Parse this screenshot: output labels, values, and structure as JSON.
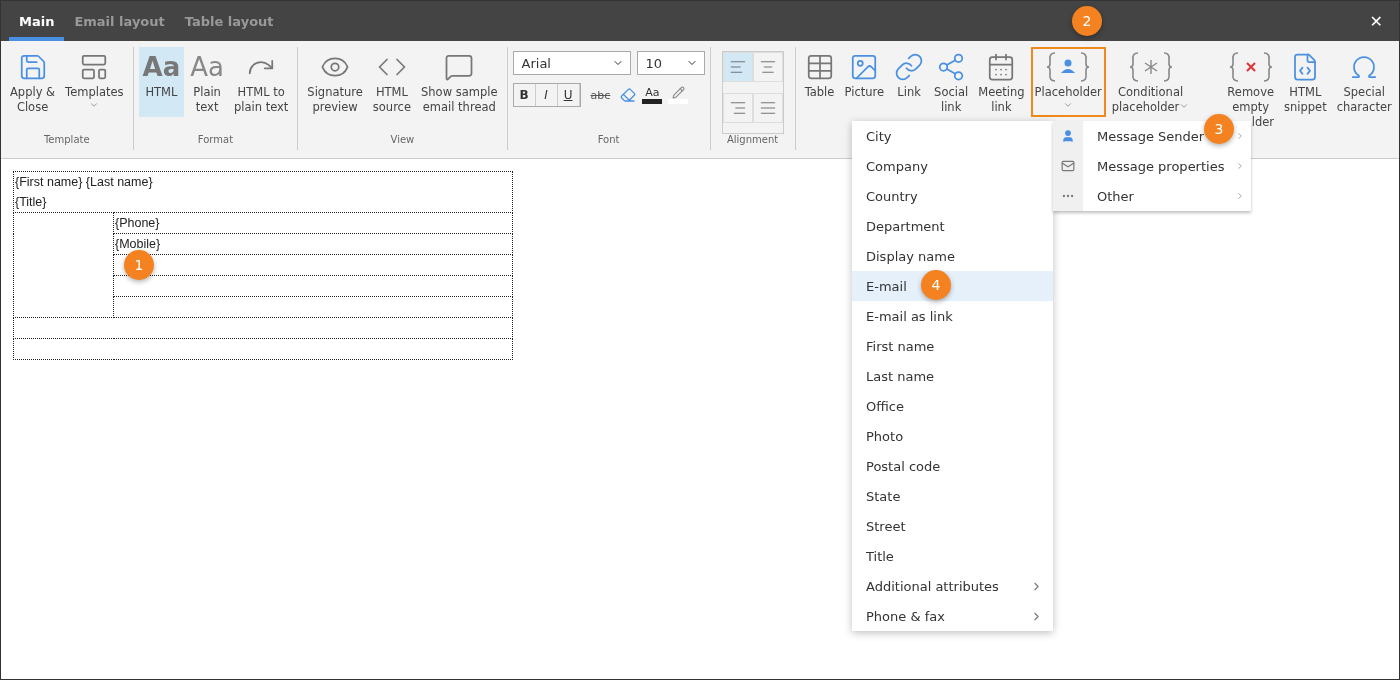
{
  "tabs": [
    {
      "label": "Main",
      "selected": true
    },
    {
      "label": "Email layout",
      "selected": false
    },
    {
      "label": "Table layout",
      "selected": false
    }
  ],
  "close": "✕",
  "groups": [
    {
      "kind": "buttons",
      "label": "Template",
      "items": [
        {
          "label": [
            "Apply &",
            "Close"
          ],
          "selected": false,
          "dropdown": false
        },
        {
          "label": [
            "Templates"
          ],
          "selected": false,
          "dropdown": true
        }
      ]
    },
    {
      "kind": "buttons",
      "label": "Format",
      "items": [
        {
          "glyph": "Aa",
          "label": [
            "HTML"
          ],
          "selected": true,
          "dropdown": false
        },
        {
          "glyph": "Aa",
          "label": [
            "Plain",
            "text"
          ],
          "selected": false,
          "dropdown": false
        },
        {
          "label": [
            "HTML to",
            "plain text"
          ],
          "selected": false,
          "dropdown": false
        }
      ]
    },
    {
      "kind": "buttons",
      "label": "View",
      "items": [
        {
          "label": [
            "Signature",
            "preview"
          ],
          "selected": false,
          "dropdown": false
        },
        {
          "label": [
            "HTML",
            "source"
          ],
          "selected": false,
          "dropdown": false
        },
        {
          "label": [
            "Show sample",
            "email thread"
          ],
          "selected": false,
          "dropdown": false
        }
      ]
    },
    {
      "kind": "font",
      "label": "Font",
      "font": "Arial",
      "size": "10",
      "styles": [
        "B",
        "I",
        "U",
        "abc"
      ],
      "color_glyph": "Aa"
    },
    {
      "kind": "align",
      "label": "Alignment",
      "options": [
        {
          "selected": true
        },
        {
          "selected": false
        },
        {
          "selected": false
        },
        {
          "selected": false
        }
      ]
    },
    {
      "kind": "buttons",
      "items": [
        {
          "label": [
            "Table"
          ],
          "selected": false,
          "dropdown": false
        },
        {
          "label": [
            "Picture"
          ],
          "selected": false,
          "dropdown": false
        },
        {
          "label": [
            "Link"
          ],
          "selected": false,
          "dropdown": false
        },
        {
          "label": [
            "Social",
            "link"
          ],
          "selected": false,
          "dropdown": false
        },
        {
          "label": [
            "Meeting",
            "link"
          ],
          "selected": false,
          "dropdown": false
        },
        {
          "label": [
            "Placeholder"
          ],
          "selected": true,
          "dropdown": true
        },
        {
          "label": [
            "Conditional",
            "placeholder"
          ],
          "selected": false,
          "dropdown": true
        },
        {
          "label": [
            "Remove",
            "empty",
            "lder"
          ],
          "selected": false,
          "dropdown": false
        },
        {
          "label": [
            "HTML",
            "snippet"
          ],
          "selected": false,
          "dropdown": false
        },
        {
          "label": [
            "Special",
            "character"
          ],
          "selected": false,
          "dropdown": false
        }
      ]
    }
  ],
  "signature": {
    "name_line": "{First name} {Last name}",
    "title_line": "{Title}",
    "contact_lines": [
      "{Phone}",
      "{Mobile}"
    ]
  },
  "menu": [
    {
      "label": "City",
      "selected": false,
      "submenu": false
    },
    {
      "label": "Company",
      "selected": false,
      "submenu": false
    },
    {
      "label": "Country",
      "selected": false,
      "submenu": false
    },
    {
      "label": "Department",
      "selected": false,
      "submenu": false
    },
    {
      "label": "Display name",
      "selected": false,
      "submenu": false
    },
    {
      "label": "E-mail",
      "selected": true,
      "submenu": false
    },
    {
      "label": "E-mail as link",
      "selected": false,
      "submenu": false
    },
    {
      "label": "First name",
      "selected": false,
      "submenu": false
    },
    {
      "label": "Last name",
      "selected": false,
      "submenu": false
    },
    {
      "label": "Office",
      "selected": false,
      "submenu": false
    },
    {
      "label": "Photo",
      "selected": false,
      "submenu": false
    },
    {
      "label": "Postal code",
      "selected": false,
      "submenu": false
    },
    {
      "label": "State",
      "selected": false,
      "submenu": false
    },
    {
      "label": "Street",
      "selected": false,
      "submenu": false
    },
    {
      "label": "Title",
      "selected": false,
      "submenu": false
    },
    {
      "label": "Additional attributes",
      "selected": false,
      "submenu": true
    },
    {
      "label": "Phone & fax",
      "selected": false,
      "submenu": true
    }
  ],
  "placeholder_menu": [
    {
      "kind": "person",
      "label": "Message Sender"
    },
    {
      "kind": "mail",
      "label": "Message properties"
    },
    {
      "kind": "dots",
      "label": "Other"
    }
  ],
  "callouts": [
    "1",
    "2",
    "3",
    "4"
  ]
}
